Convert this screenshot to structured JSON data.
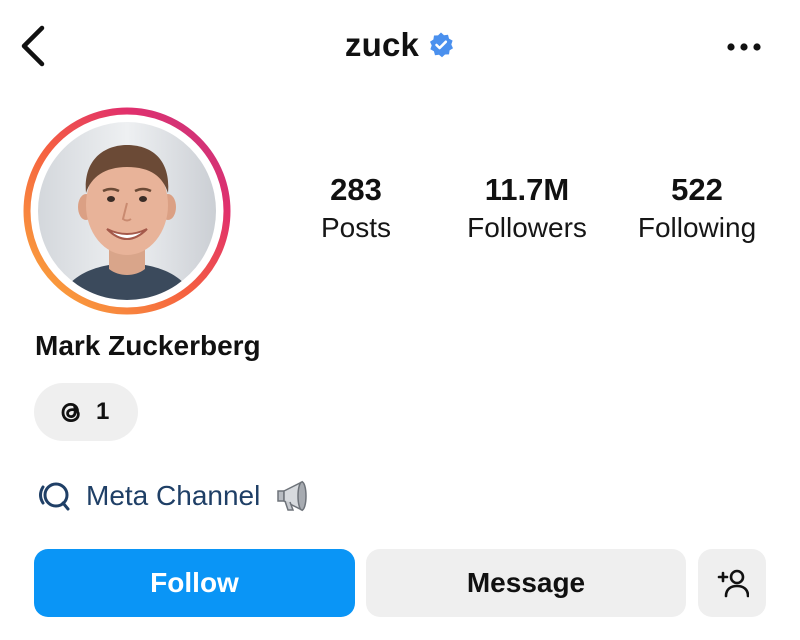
{
  "header": {
    "username": "zuck",
    "verified_color": "#4a90ee",
    "back_icon": "chevron-left-icon",
    "more_icon": "more-horizontal-icon"
  },
  "profile": {
    "display_name": "Mark Zuckerberg",
    "avatar": "profile-photo",
    "story_ring_colors": [
      "#f9a825",
      "#e91e63",
      "#c2185b"
    ]
  },
  "stats": [
    {
      "value": "283",
      "label": "Posts"
    },
    {
      "value": "11.7M",
      "label": "Followers"
    },
    {
      "value": "522",
      "label": "Following"
    }
  ],
  "threads_badge": {
    "icon": "threads-icon",
    "count": "1"
  },
  "channel": {
    "icon": "broadcast-channel-icon",
    "label": "Meta Channel",
    "emoji_icon": "megaphone-icon"
  },
  "actions": {
    "follow_label": "Follow",
    "message_label": "Message",
    "suggest_icon": "add-person-icon",
    "follow_color": "#0a95f6"
  }
}
